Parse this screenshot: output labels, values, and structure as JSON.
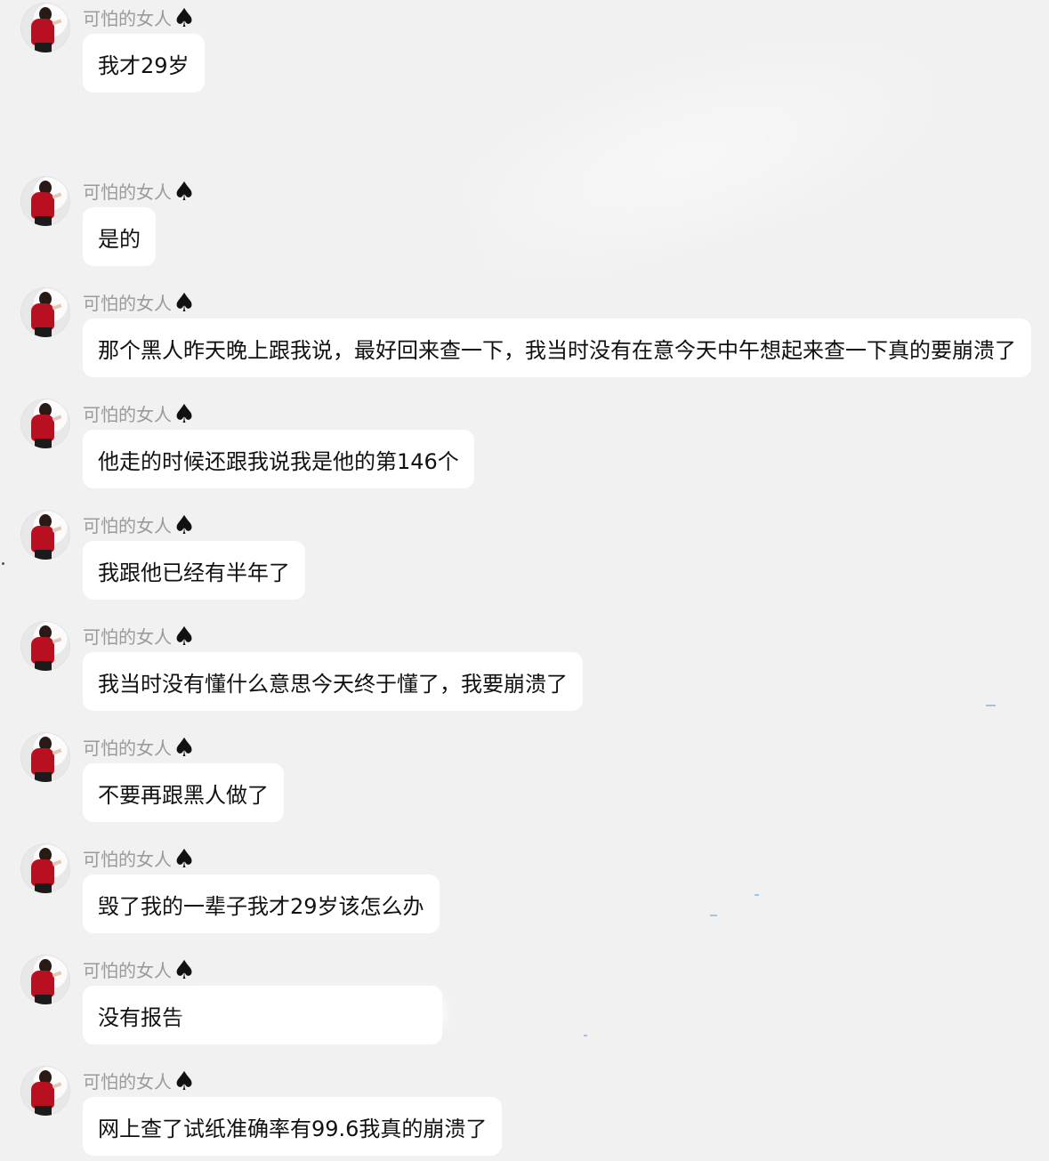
{
  "sender": {
    "name": "可怕的女人",
    "badge_icon": "spade-icon",
    "badge_symbol": "♠"
  },
  "messages": [
    {
      "text": "我才29岁"
    },
    {
      "text": "是的"
    },
    {
      "text": "那个黑人昨天晚上跟我说，最好回来查一下，我当时没有在意今天中午想起来查一下真的要崩溃了"
    },
    {
      "text": "他走的时候还跟我说我是他的第146个"
    },
    {
      "text": "我跟他已经有半年了"
    },
    {
      "text": "我当时没有懂什么意思今天终于懂了，我要崩溃了"
    },
    {
      "text": "不要再跟黑人做了"
    },
    {
      "text": "毁了我的一辈子我才29岁该怎么办"
    },
    {
      "text": "没有报告"
    },
    {
      "text": "网上查了试纸准确率有99.6我真的崩溃了"
    }
  ]
}
